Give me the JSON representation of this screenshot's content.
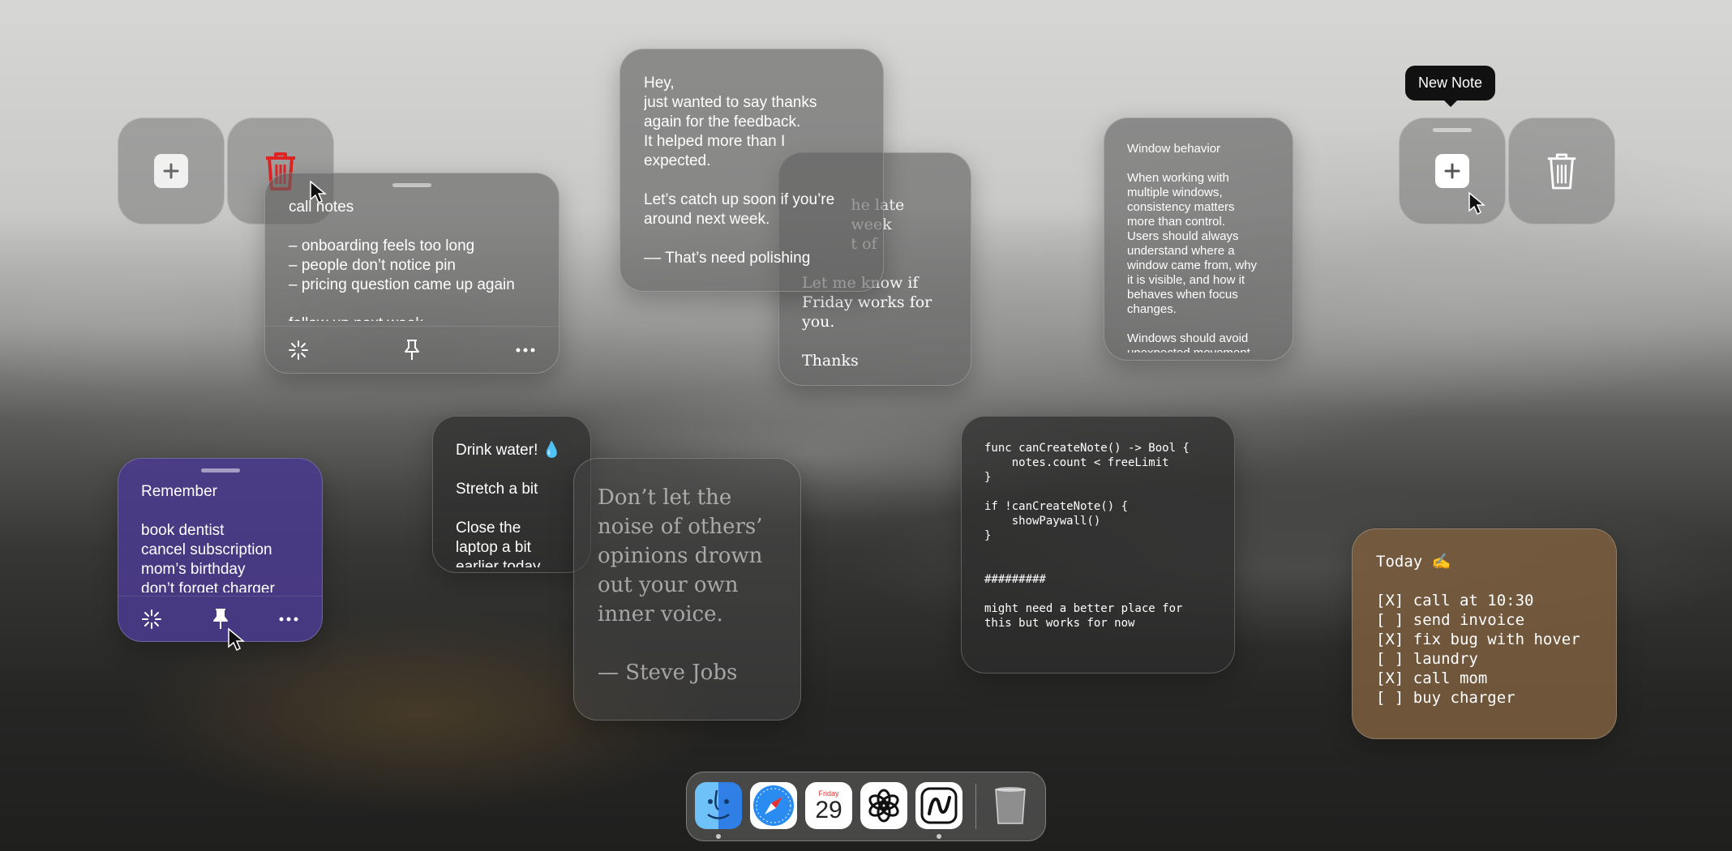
{
  "tooltip": {
    "text": "New Note"
  },
  "notes": {
    "call_notes": {
      "text": "call notes\n\n– onboarding feels too long\n– people don’t notice pin\n– pricing question came up again\n\nfollow up next week"
    },
    "thanks": {
      "text": "Hey,\njust wanted to say thanks\nagain for the feedback.\nIt helped more than I\nexpected.\n\nLet’s catch up soon if you’re\naround next week.\n\n–– That’s need polishing"
    },
    "friday": {
      "text": "          he late\n          week\n          t of\n\nLet me know if\nFriday works for\nyou.\n\nThanks"
    },
    "window_behavior": {
      "text": "Window behavior\n\nWhen working with\nmultiple windows,\nconsistency matters\nmore than control.\nUsers should always\nunderstand where a\nwindow came from, why\nit is visible, and how it\nbehaves when focus\nchanges.\n\nWindows should avoid\nunexpected movement"
    },
    "remember": {
      "text": "Remember\n\nbook dentist\ncancel subscription\nmom’s birthday\ndon’t forget charger"
    },
    "drink": {
      "text": "Drink water! 💧\n\nStretch a bit\n\nClose the\nlaptop a bit\nearlier today"
    },
    "quote": {
      "text": "Don’t let the\nnoise of others’\nopinions drown\nout your own\ninner voice.\n\n— Steve Jobs"
    },
    "code": {
      "text": "func canCreateNote() -> Bool {\n    notes.count < freeLimit\n}\n\nif !canCreateNote() {\n    showPaywall()\n}\n\n\n#########\n\nmight need a better place for\nthis but works for now"
    },
    "today": {
      "text": "Today ✍️\n\n[X] call at 10:30\n[ ] send invoice\n[X] fix bug with hover\n[ ] laundry\n[X] call mom\n[ ] buy charger"
    }
  },
  "dock": {
    "calendar_day": "Friday",
    "calendar_date": "29"
  },
  "colors": {
    "remember_note": "#4a3a8c",
    "today_note": "#7a5c3e",
    "trash_active": "#e02424"
  },
  "icons": [
    "plus-icon",
    "trash-icon",
    "sparkle-icon",
    "pin-icon",
    "more-icon",
    "finder-icon",
    "safari-icon",
    "calendar-icon",
    "chatgpt-icon",
    "notes-app-icon"
  ]
}
